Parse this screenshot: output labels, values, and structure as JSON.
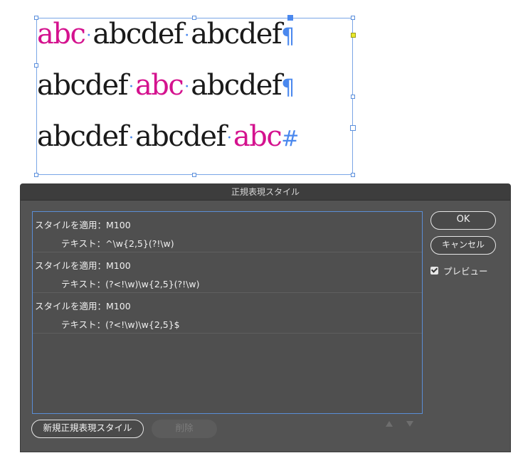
{
  "canvas": {
    "lines": [
      [
        {
          "text": "abc",
          "pink": true
        },
        {
          "text": "abcdef",
          "pink": false
        },
        {
          "text": "abcdef",
          "pink": false
        }
      ],
      [
        {
          "text": "abcdef",
          "pink": false
        },
        {
          "text": "abc",
          "pink": true
        },
        {
          "text": "abcdef",
          "pink": false
        }
      ],
      [
        {
          "text": "abcdef",
          "pink": false
        },
        {
          "text": "abcdef",
          "pink": false
        },
        {
          "text": "abc",
          "pink": true
        }
      ]
    ],
    "space_marker": "·",
    "line_end_markers": [
      "¶",
      "¶",
      "#"
    ],
    "colors": {
      "highlight": "#d4128e",
      "marker": "#4a88ee",
      "text": "#1a1a1a"
    }
  },
  "dialog": {
    "title": "正規表現スタイル",
    "rules": [
      {
        "style_line": "スタイルを適用：M100",
        "text_line": "テキスト：^\\w{2,5}(?!\\w)"
      },
      {
        "style_line": "スタイルを適用：M100",
        "text_line": "テキスト：(?<!\\w)\\w{2,5}(?!\\w)"
      },
      {
        "style_line": "スタイルを適用：M100",
        "text_line": "テキスト：(?<!\\w)\\w{2,5}$"
      }
    ],
    "ok_label": "OK",
    "cancel_label": "キャンセル",
    "preview_label": "プレビュー",
    "preview_checked": true,
    "new_label": "新規正規表現スタイル",
    "delete_label": "削除",
    "move_up_icon": "triangle-up-icon",
    "move_down_icon": "triangle-down-icon"
  }
}
